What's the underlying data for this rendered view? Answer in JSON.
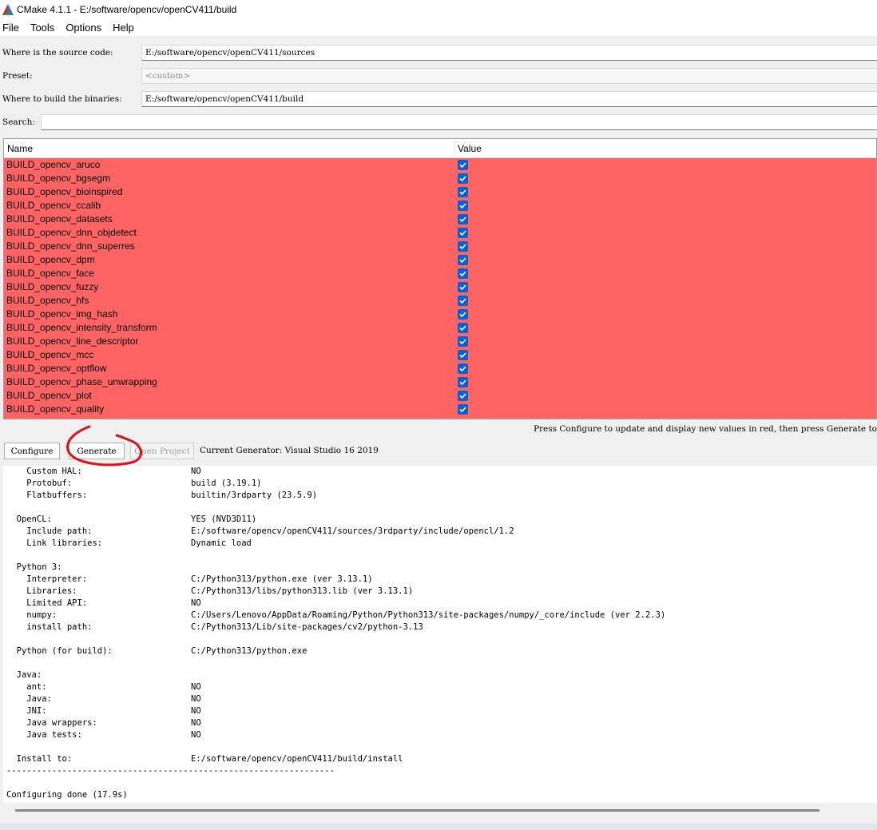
{
  "window": {
    "title": "CMake 4.1.1 - E:/software/opencv/openCV411/build",
    "icon": "cmake-triangle-icon"
  },
  "menu": [
    "File",
    "Tools",
    "Options",
    "Help"
  ],
  "paths": {
    "source_label": "Where is the source code:",
    "source_value": "E:/software/opencv/openCV411/sources",
    "preset_label": "Preset:",
    "preset_value": "<custom>",
    "build_label": "Where to build the binaries:",
    "build_value": "E:/software/opencv/openCV411/build",
    "search_label": "Search:",
    "search_value": ""
  },
  "table": {
    "columns": [
      "Name",
      "Value"
    ],
    "rows": [
      "BUILD_opencv_aruco",
      "BUILD_opencv_bgsegm",
      "BUILD_opencv_bioinspired",
      "BUILD_opencv_ccalib",
      "BUILD_opencv_datasets",
      "BUILD_opencv_dnn_objdetect",
      "BUILD_opencv_dnn_superres",
      "BUILD_opencv_dpm",
      "BUILD_opencv_face",
      "BUILD_opencv_fuzzy",
      "BUILD_opencv_hfs",
      "BUILD_opencv_img_hash",
      "BUILD_opencv_intensity_transform",
      "BUILD_opencv_line_descriptor",
      "BUILD_opencv_mcc",
      "BUILD_opencv_optflow",
      "BUILD_opencv_phase_unwrapping",
      "BUILD_opencv_plot",
      "BUILD_opencv_quality"
    ],
    "row_color": "#ff6464",
    "checked": true
  },
  "hint": "Press Configure to update and display new values in red, then press Generate to",
  "buttons": {
    "configure": "Configure",
    "generate": "Generate",
    "open_project": "Open Project"
  },
  "generator": "Current Generator: Visual Studio 16 2019",
  "output_lines": [
    [
      "    Custom HAL:",
      "NO"
    ],
    [
      "    Protobuf:",
      "build (3.19.1)"
    ],
    [
      "    Flatbuffers:",
      "builtin/3rdparty (23.5.9)"
    ],
    [
      "",
      ""
    ],
    [
      "  OpenCL:",
      "YES (NVD3D11)"
    ],
    [
      "    Include path:",
      "E:/software/opencv/openCV411/sources/3rdparty/include/opencl/1.2"
    ],
    [
      "    Link libraries:",
      "Dynamic load"
    ],
    [
      "",
      ""
    ],
    [
      "  Python 3:",
      ""
    ],
    [
      "    Interpreter:",
      "C:/Python313/python.exe (ver 3.13.1)"
    ],
    [
      "    Libraries:",
      "C:/Python313/libs/python313.lib (ver 3.13.1)"
    ],
    [
      "    Limited API:",
      "NO"
    ],
    [
      "    numpy:",
      "C:/Users/Lenovo/AppData/Roaming/Python/Python313/site-packages/numpy/_core/include (ver 2.2.3)"
    ],
    [
      "    install path:",
      "C:/Python313/Lib/site-packages/cv2/python-3.13"
    ],
    [
      "",
      ""
    ],
    [
      "  Python (for build):",
      "C:/Python313/python.exe"
    ],
    [
      "",
      ""
    ],
    [
      "  Java:",
      ""
    ],
    [
      "    ant:",
      "NO"
    ],
    [
      "    Java:",
      "NO"
    ],
    [
      "    JNI:",
      "NO"
    ],
    [
      "    Java wrappers:",
      "NO"
    ],
    [
      "    Java tests:",
      "NO"
    ],
    [
      "",
      ""
    ],
    [
      "  Install to:",
      "E:/software/opencv/openCV411/build/install"
    ],
    [
      "-----------------------------------------------------------------",
      ""
    ],
    [
      "",
      ""
    ],
    [
      "Configuring done (17.9s)",
      ""
    ]
  ],
  "colors": {
    "accent": "#0a5fd1",
    "annotation": "#e0101a"
  }
}
